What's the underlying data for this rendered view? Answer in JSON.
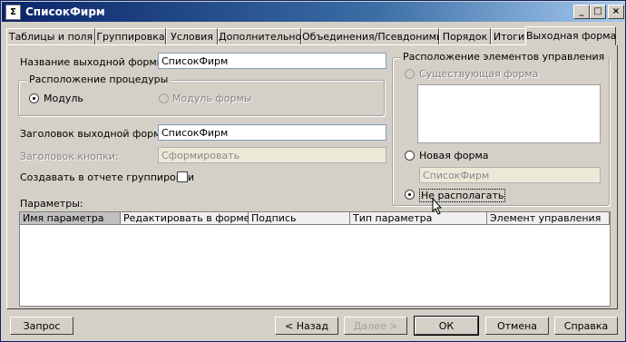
{
  "window": {
    "title": "СписокФирм",
    "controls": {
      "minimize": "_",
      "maximize": "□",
      "close": "×"
    }
  },
  "tabs": [
    {
      "label": "Таблицы и поля"
    },
    {
      "label": "Группировка"
    },
    {
      "label": "Условия"
    },
    {
      "label": "Дополнительно"
    },
    {
      "label": "Объединения/Псевдонимы"
    },
    {
      "label": "Порядок"
    },
    {
      "label": "Итоги"
    },
    {
      "label": "Выходная форма"
    }
  ],
  "form": {
    "output_form_name_label": "Название выходной формы:",
    "output_form_name_value": "СписокФирм",
    "procedure_location_group": "Расположение процедуры",
    "radio_module": "Модуль",
    "radio_form_module": "Модуль формы",
    "output_form_title_label": "Заголовок выходной формы:",
    "output_form_title_value": "СписокФирм",
    "button_title_label": "Заголовок кнопки:",
    "button_title_value": "Сформировать",
    "create_grouping_label": "Создавать в отчете группировки",
    "params_label": "Параметры:"
  },
  "controls_location": {
    "group_label": "Расположение элементов управления",
    "existing_form": "Существующая форма",
    "new_form": "Новая форма",
    "new_form_name": "СписокФирм",
    "do_not_place": "Не располагать"
  },
  "params_grid": {
    "columns": [
      "Имя параметра",
      "Редактировать в форме",
      "Подпись",
      "Тип параметра",
      "Элемент управления"
    ]
  },
  "buttons": {
    "request": "Запрос",
    "back": "< Назад",
    "next": "Далее >",
    "ok": "ОК",
    "cancel": "Отмена",
    "help": "Справка"
  }
}
